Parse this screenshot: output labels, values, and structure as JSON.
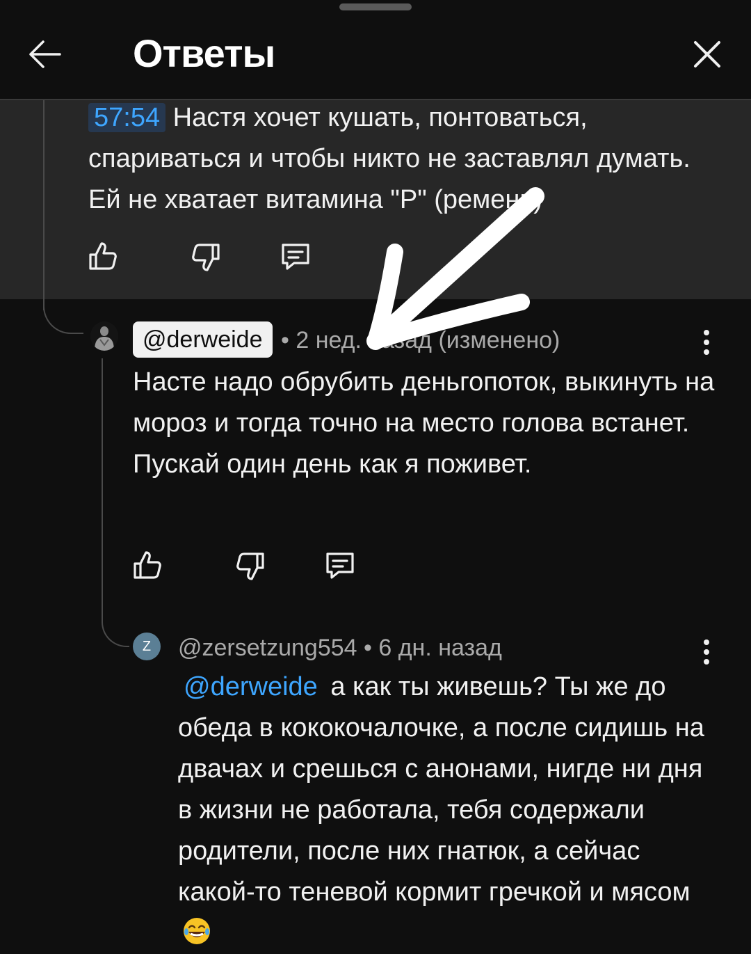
{
  "header": {
    "title": "Ответы",
    "back_icon": "arrow-left-icon",
    "close_icon": "close-icon"
  },
  "parent_comment": {
    "timestamp": "57:54",
    "text": "Настя хочет кушать, понтоваться, спариваться и чтобы никто не заставлял думать. Ей не хватает витамина \"Р\" (ремень)",
    "actions": [
      "thumbs-up-icon",
      "thumbs-down-icon",
      "reply-icon"
    ]
  },
  "reply1": {
    "handle": "@derweide",
    "meta": "• 2 нед. назад (изменено)",
    "text": "Насте надо обрубить деньгопоток, выкинуть на мороз и тогда точно на место голова встанет. Пускай один день как я поживет.",
    "actions": [
      "thumbs-up-icon",
      "thumbs-down-icon",
      "reply-icon"
    ]
  },
  "reply2": {
    "avatar_letter": "Z",
    "avatar_color": "#5b7f95",
    "meta": "@zersetzung554 • 6 дн. назад",
    "mention": "@derweide",
    "text": "а как ты живешь? Ты же до обеда в кококочалочке, а после сидишь на двачах и срешься с анонами, нигде ни дня в жизни не работала, тебя содержали родители, после них гнатюк, а сейчас какой-то теневой кормит гречкой и мясом"
  },
  "colors": {
    "background": "#0f0f0f",
    "card": "#272727",
    "link": "#3ea6ff",
    "secondary_text": "#aaaaaa"
  }
}
